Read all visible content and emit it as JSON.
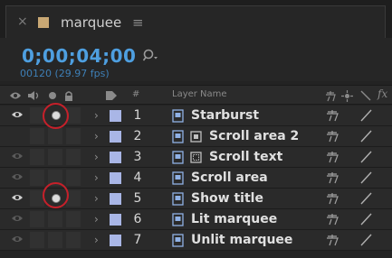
{
  "tab": {
    "close_glyph": "×",
    "title": "marquee",
    "menu_glyph": "≡",
    "swatch_color": "#c9a874"
  },
  "time": {
    "timecode": "0;00;04;00",
    "frames": "00120 (29.97 fps)"
  },
  "search": {
    "icon": "search-icon"
  },
  "header": {
    "num": "#",
    "layer_name": "Layer Name"
  },
  "layers": [
    {
      "num": "1",
      "name": "Starburst",
      "visible": true,
      "solo": true,
      "extra_icon": null
    },
    {
      "num": "2",
      "name": "Scroll area 2",
      "visible": false,
      "solo": false,
      "extra_icon": "solid-square-icon"
    },
    {
      "num": "3",
      "name": "Scroll text",
      "visible": false,
      "solo": false,
      "extra_icon": "dotted-square-icon"
    },
    {
      "num": "4",
      "name": "Scroll area",
      "visible": false,
      "solo": false,
      "extra_icon": null
    },
    {
      "num": "5",
      "name": "Show title",
      "visible": true,
      "solo": true,
      "extra_icon": null
    },
    {
      "num": "6",
      "name": "Lit marquee",
      "visible": false,
      "solo": false,
      "extra_icon": null
    },
    {
      "num": "7",
      "name": "Unlit marquee",
      "visible": false,
      "solo": false,
      "extra_icon": null
    }
  ],
  "colors": {
    "timecode": "#4e9fe0",
    "label": "#a9b6e6",
    "highlight": "#c6202a"
  }
}
